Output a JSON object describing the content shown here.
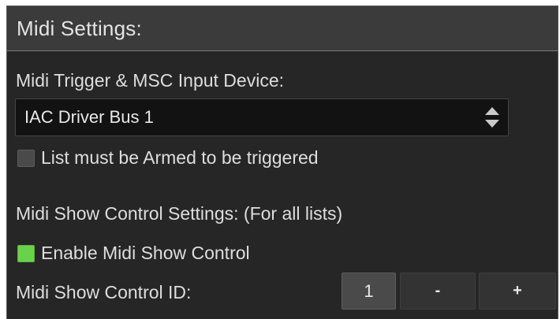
{
  "header": {
    "title": "Midi Settings:"
  },
  "trigger": {
    "label": "Midi Trigger & MSC Input Device:",
    "device_value": "IAC Driver Bus 1",
    "arm_checkbox_label": "List must be Armed to be triggered",
    "arm_checked": false
  },
  "msc": {
    "section_label": "Midi Show Control Settings: (For all lists)",
    "enable_label": "Enable Midi Show Control",
    "enable_checked": true,
    "id_label": "Midi Show Control ID:",
    "id_value": "1",
    "decrement_label": "-",
    "increment_label": "+"
  },
  "colors": {
    "panel_bg": "#262626",
    "header_bg": "#3b3b3b",
    "checkbox_on": "#69d24a",
    "checkbox_off": "#4a4a4a"
  },
  "icons": {
    "select_arrows": "up-down-chevrons-icon"
  }
}
